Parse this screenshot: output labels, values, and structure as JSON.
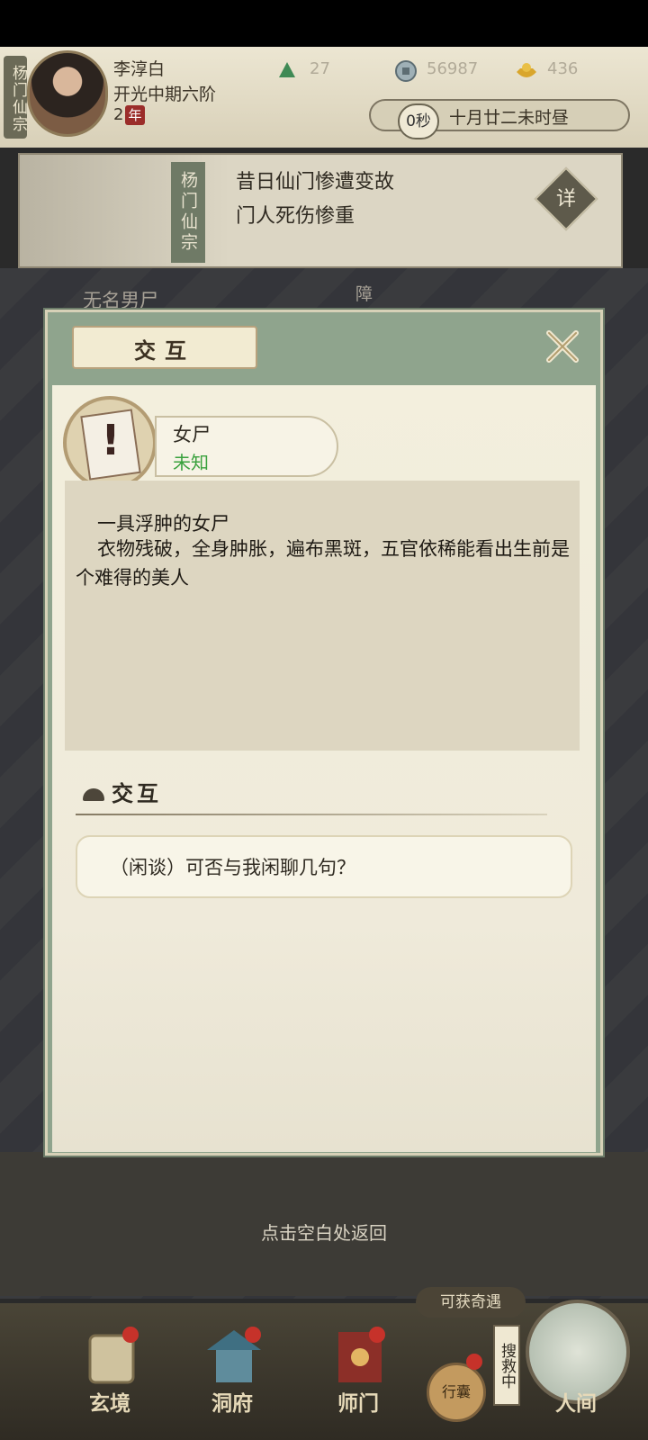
{
  "header": {
    "sect_tag": "杨门仙宗",
    "character_name": "李淳白",
    "character_realm": "开光中期六阶",
    "years_value": "2",
    "years_unit": "年",
    "resources": [
      {
        "icon": "jade-icon",
        "value": "27"
      },
      {
        "icon": "coin-icon",
        "value": "56987"
      },
      {
        "icon": "ingot-icon",
        "value": "436"
      }
    ],
    "timer": "0秒",
    "date": "十月廿二未时昼"
  },
  "notice": {
    "sect_label": "杨门仙宗",
    "line1": "昔日仙门惨遭变故",
    "line2": "门人死伤惨重",
    "detail_button": "详"
  },
  "scene": {
    "label": "无名男尸",
    "side_text": "障"
  },
  "dialog": {
    "title": "交互",
    "npc_name": "女尸",
    "npc_status": "未知",
    "description_line1": "一具浮肿的女尸",
    "description_line2": "衣物残破，全身肿胀，遍布黑斑，五官依稀能看出生前是个难得的美人",
    "section_title": "交互",
    "options": [
      "（闲谈）可否与我闲聊几句？"
    ]
  },
  "back_hint": "点击空白处返回",
  "bottom_nav": {
    "encounter_tag": "可获奇遇",
    "search_tag": "搜救中",
    "bag_label": "行囊",
    "items": [
      {
        "label": "玄境",
        "icon": "scroll-icon"
      },
      {
        "label": "洞府",
        "icon": "pavilion-icon"
      },
      {
        "label": "师门",
        "icon": "banner-icon"
      },
      {
        "label": "人间",
        "icon": "mountain-icon"
      }
    ]
  },
  "colors": {
    "dialog_frame": "#8fa48d",
    "status_green": "#3aa13d",
    "badge_red": "#9b2d2a"
  }
}
